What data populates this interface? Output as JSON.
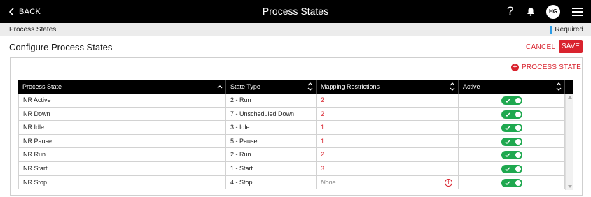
{
  "header": {
    "back_label": "BACK",
    "title": "Process States",
    "help_label": "?",
    "avatar_initials": "HG",
    "icons": [
      "chevron-left-icon",
      "help-icon",
      "bell-icon",
      "avatar",
      "hamburger-menu-icon"
    ]
  },
  "breadcrumb": {
    "label": "Process States",
    "required_label": "Required",
    "required_color": "#2b9be5"
  },
  "page": {
    "title": "Configure Process States",
    "cancel_label": "CANCEL",
    "save_label": "SAVE",
    "accent_color": "#d9232e"
  },
  "toolbar": {
    "add_state_label": "PROCESS STATE"
  },
  "table": {
    "columns": [
      "Process State",
      "State Type",
      "Mapping Restrictions",
      "Active"
    ],
    "rows": [
      {
        "process_state": "NR Active",
        "state_type": "2 - Run",
        "mapping": "2",
        "active": true
      },
      {
        "process_state": "NR Down",
        "state_type": "7 - Unscheduled Down",
        "mapping": "2",
        "active": true
      },
      {
        "process_state": "NR Idle",
        "state_type": "3 - Idle",
        "mapping": "1",
        "active": true
      },
      {
        "process_state": "NR Pause",
        "state_type": "5 - Pause",
        "mapping": "1",
        "active": true
      },
      {
        "process_state": "NR Run",
        "state_type": "2 - Run",
        "mapping": "2",
        "active": true
      },
      {
        "process_state": "NR Start",
        "state_type": "1 - Start",
        "mapping": "3",
        "active": true
      },
      {
        "process_state": "NR Stop",
        "state_type": "4 - Stop",
        "mapping": "None",
        "active": true
      }
    ],
    "toggle_color": "#1fa84f"
  }
}
